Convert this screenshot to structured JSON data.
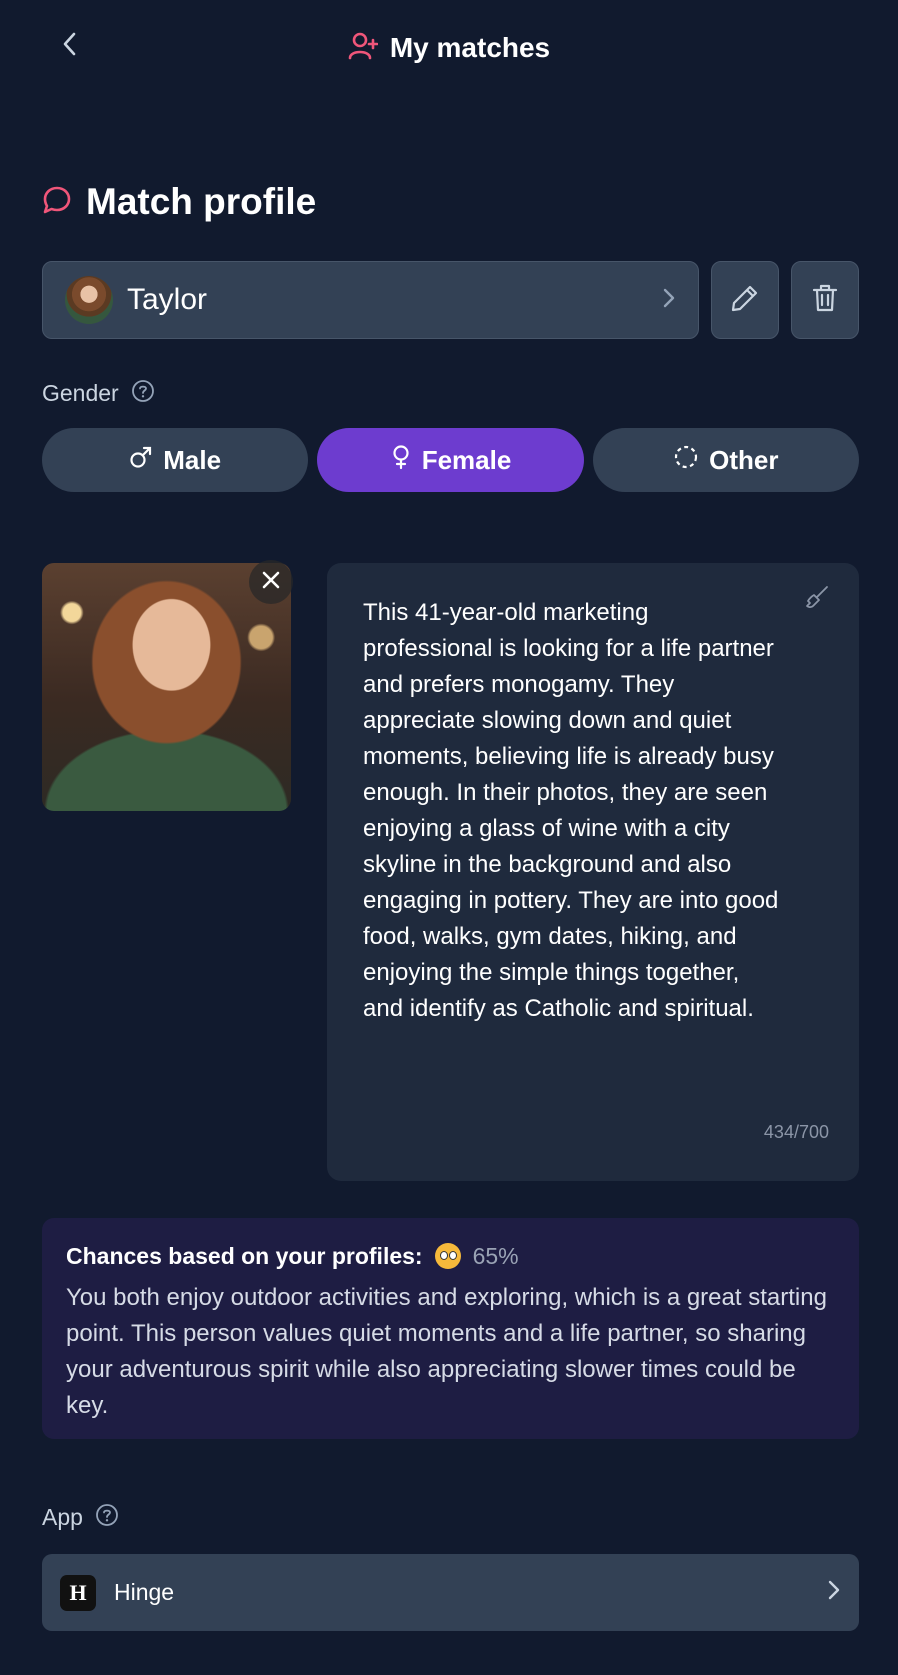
{
  "header": {
    "title": "My matches"
  },
  "section": {
    "title": "Match profile"
  },
  "match": {
    "name": "Taylor"
  },
  "gender": {
    "label": "Gender",
    "options": [
      {
        "label": "Male",
        "selected": false
      },
      {
        "label": "Female",
        "selected": true
      },
      {
        "label": "Other",
        "selected": false
      }
    ]
  },
  "description": {
    "text": "This 41-year-old marketing professional is looking for a life partner and prefers monogamy. They appreciate slowing down and quiet moments, believing life is already busy enough. In their photos, they are seen enjoying a glass of wine with a city skyline in the background and also engaging in pottery. They are into good food, walks, gym dates, hiking, and enjoying the simple things together, and identify as Catholic and spiritual.",
    "char_count": "434/700"
  },
  "chances": {
    "title": "Chances based on your profiles:",
    "percent": "65%",
    "body": "You both enjoy outdoor activities and exploring, which is a great starting point. This person values quiet moments and a life partner, so sharing your adventurous spirit while also appreciating slower times could be key."
  },
  "app": {
    "label": "App",
    "selected": "Hinge",
    "logo_glyph": "H"
  },
  "colors": {
    "background": "#111a2e",
    "accent_pink": "#f0567a",
    "accent_purple": "#6d3ccf",
    "field_bg": "#334155"
  }
}
